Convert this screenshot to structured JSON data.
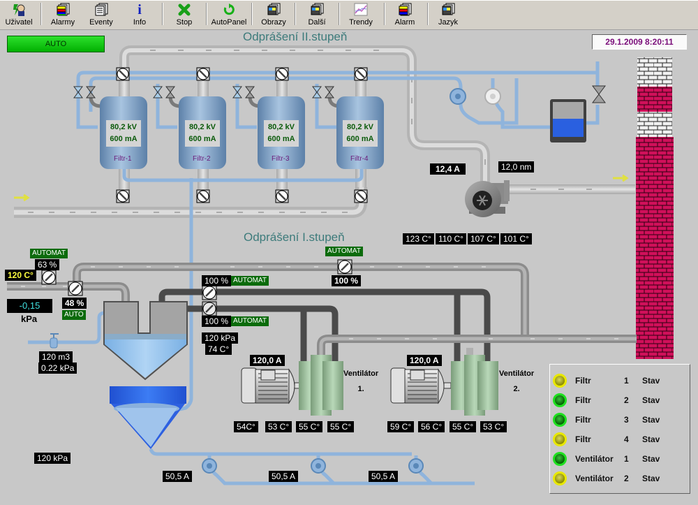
{
  "toolbar": {
    "buttons": [
      {
        "label": "Uživatel",
        "icon": "user-icon"
      },
      {
        "label": "Alarmy",
        "icon": "alarms-icon"
      },
      {
        "label": "Eventy",
        "icon": "events-icon"
      },
      {
        "label": "Info",
        "icon": "info-icon"
      },
      {
        "label": "Stop",
        "icon": "stop-icon"
      },
      {
        "label": "AutoPanel",
        "icon": "autopanel-icon"
      },
      {
        "label": "Obrazy",
        "icon": "screens-icon"
      },
      {
        "label": "Další",
        "icon": "next-icon"
      },
      {
        "label": "Trendy",
        "icon": "trends-icon"
      },
      {
        "label": "Alarm",
        "icon": "alarm-icon"
      },
      {
        "label": "Jazyk",
        "icon": "language-icon"
      }
    ]
  },
  "mode": "AUTO",
  "datetime": "29.1.2009 8:20:11",
  "stage2": {
    "title": "Odprášení II.stupeň",
    "filters": [
      {
        "name": "Filtr-1",
        "voltage": "80,2 kV",
        "current": "600 mA"
      },
      {
        "name": "Filtr-2",
        "voltage": "80,2 kV",
        "current": "600 mA"
      },
      {
        "name": "Filtr-3",
        "voltage": "80,2 kV",
        "current": "600 mA"
      },
      {
        "name": "Filtr-4",
        "voltage": "80,2 kV",
        "current": "600 mA"
      }
    ],
    "fan": {
      "current": "12,4 A",
      "torque": "12,0 nm",
      "temps": [
        "123 C°",
        "110 C°",
        "107 C°",
        "101 C°"
      ]
    }
  },
  "stage1": {
    "title": "Odprášení I.stupeň",
    "inlet": {
      "mode": "AUTOMAT",
      "damper_pct": "63 %",
      "temperature": "120 C°",
      "pressure": "-0,15",
      "pressure_unit": "kPa",
      "valve_pct": "48 %",
      "valve_mode": "AUTO",
      "water_volume": "120 m3",
      "water_pressure": "0.22 kPa"
    },
    "bypass_damper": {
      "mode": "AUTOMAT",
      "pct": "100 %"
    },
    "damper_upper": {
      "pct": "100 %",
      "mode": "AUTOMAT"
    },
    "damper_lower": {
      "pct": "100 %",
      "mode": "AUTOMAT"
    },
    "cyclone": {
      "pressure": "120 kPa",
      "temperature": "74 C°"
    },
    "ventilators": [
      {
        "label": "Ventilátor",
        "num": "1.",
        "current": "120,0 A",
        "temps": [
          "54C°",
          "53 C°",
          "55 C°",
          "55 C°"
        ]
      },
      {
        "label": "Ventilátor",
        "num": "2.",
        "current": "120,0 A",
        "temps": [
          "59 C°",
          "56 C°",
          "55 C°",
          "53 C°"
        ]
      }
    ],
    "bottom_pressure": "120 kPa",
    "pumps": [
      "50,5 A",
      "50,5 A",
      "50,5 A"
    ]
  },
  "status_panel": {
    "rows": [
      {
        "name": "Filtr",
        "num": "1",
        "label": "Stav",
        "state": "yellow"
      },
      {
        "name": "Filtr",
        "num": "2",
        "label": "Stav",
        "state": "green"
      },
      {
        "name": "Filtr",
        "num": "3",
        "label": "Stav",
        "state": "green"
      },
      {
        "name": "Filtr",
        "num": "4",
        "label": "Stav",
        "state": "yellow"
      },
      {
        "name": "Ventilátor",
        "num": "1",
        "label": "Stav",
        "state": "green"
      },
      {
        "name": "Ventilátor",
        "num": "2",
        "label": "Stav",
        "state": "yellow"
      }
    ]
  },
  "colors": {
    "background": "#c8c8c8",
    "auto_green": "#00c000",
    "water_blue": "#8fb4dc",
    "chimney_red": "#d0105a",
    "title_teal": "#3d7b7b",
    "led_green": "#20e020",
    "led_yellow": "#e8e800"
  }
}
